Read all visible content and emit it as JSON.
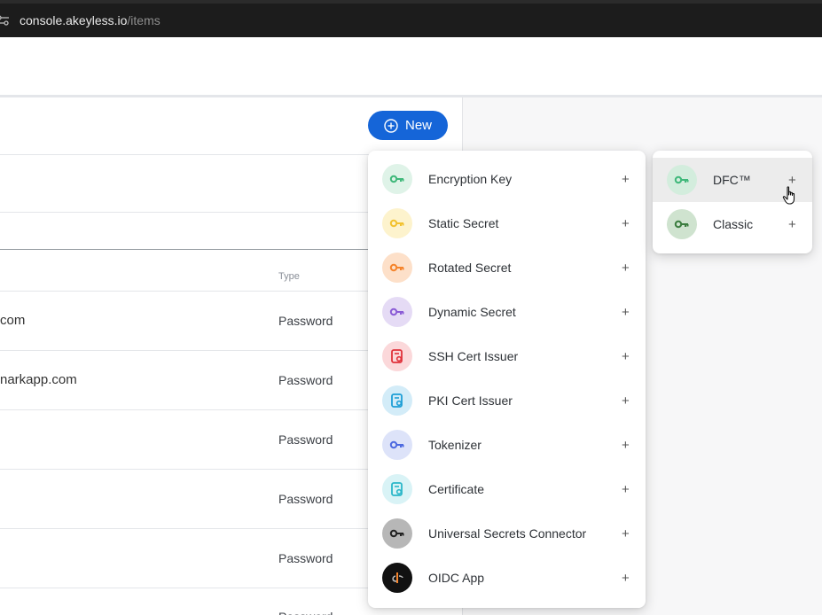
{
  "browser": {
    "url_host": "console.akeyless.io",
    "url_path": "/items"
  },
  "toolbar": {
    "new_label": "New"
  },
  "table": {
    "type_header": "Type",
    "rows": [
      {
        "name": "com",
        "type": "Password"
      },
      {
        "name": "narkapp.com",
        "type": "Password"
      },
      {
        "name": "",
        "type": "Password"
      },
      {
        "name": "",
        "type": "Password"
      },
      {
        "name": "",
        "type": "Password"
      },
      {
        "name": "",
        "type": "Password"
      }
    ]
  },
  "menu": {
    "items": [
      {
        "label": "Encryption Key",
        "icon": "key-icon",
        "color": "#3fb87a",
        "bg": "#dff3e8"
      },
      {
        "label": "Static Secret",
        "icon": "key-icon",
        "color": "#f2c230",
        "bg": "#fdf3cd"
      },
      {
        "label": "Rotated Secret",
        "icon": "key-icon",
        "color": "#f5842c",
        "bg": "#fde0c9"
      },
      {
        "label": "Dynamic Secret",
        "icon": "key-icon",
        "color": "#8b5cd6",
        "bg": "#e5dbf5"
      },
      {
        "label": "SSH Cert Issuer",
        "icon": "certificate-icon",
        "color": "#e0313a",
        "bg": "#fbd8da"
      },
      {
        "label": "PKI Cert Issuer",
        "icon": "certificate-icon",
        "color": "#1e9fd6",
        "bg": "#d3ecf8"
      },
      {
        "label": "Tokenizer",
        "icon": "key-icon",
        "color": "#4d6ae0",
        "bg": "#dde3f9"
      },
      {
        "label": "Certificate",
        "icon": "certificate-icon",
        "color": "#2bb7c9",
        "bg": "#d9f3f6"
      },
      {
        "label": "Universal Secrets Connector",
        "icon": "key-icon",
        "color": "#222222",
        "bg": "#b7b7b7"
      },
      {
        "label": "OIDC App",
        "icon": "oidc-icon",
        "color": "#f5842c",
        "bg": "#111111"
      }
    ],
    "plus": "+"
  },
  "submenu": {
    "items": [
      {
        "label": "DFC™",
        "icon": "key-icon",
        "color": "#3fb87a",
        "bg": "#d3eddd"
      },
      {
        "label": "Classic",
        "icon": "key-icon",
        "color": "#3b7d3f",
        "bg": "#cfe3cf"
      }
    ],
    "plus": "+"
  }
}
